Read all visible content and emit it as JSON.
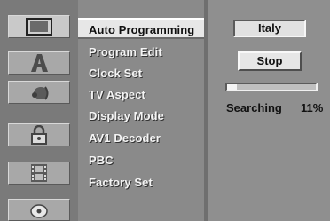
{
  "menu": {
    "items": [
      {
        "label": "Auto Programming",
        "selected": true
      },
      {
        "label": "Program Edit",
        "selected": false
      },
      {
        "label": "Clock Set",
        "selected": false
      },
      {
        "label": "TV Aspect",
        "selected": false
      },
      {
        "label": "Display Mode",
        "selected": false
      },
      {
        "label": "AV1 Decoder",
        "selected": false
      },
      {
        "label": "PBC",
        "selected": false
      },
      {
        "label": "Factory Set",
        "selected": false
      }
    ]
  },
  "icons": [
    {
      "name": "tv-screen-icon",
      "selected": true
    },
    {
      "name": "language-letter-a-icon",
      "selected": false
    },
    {
      "name": "audio-speaker-icon",
      "selected": false
    },
    {
      "name": "padlock-icon",
      "selected": false
    },
    {
      "name": "film-strip-icon",
      "selected": false
    },
    {
      "name": "disc-icon",
      "selected": false
    }
  ],
  "panel": {
    "country": "Italy",
    "stop_label": "Stop",
    "status_text": "Searching",
    "progress_percent_label": "11%",
    "progress_fraction": 0.11
  }
}
